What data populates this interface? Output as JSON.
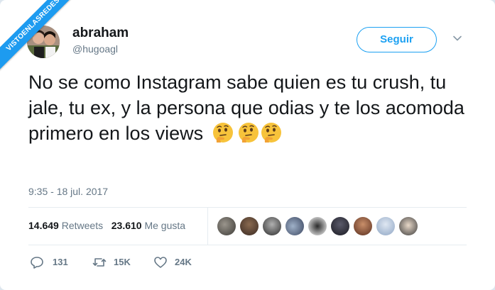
{
  "watermark": {
    "text": "VISTOENLASREDES"
  },
  "author": {
    "display_name": "abraham",
    "handle": "@hugoagl",
    "avatar_icon": "profile-photo"
  },
  "follow_button": {
    "label": "Seguir",
    "color": "#1da1f2"
  },
  "menu": {
    "icon": "chevron-down-icon"
  },
  "tweet": {
    "text": "No se como Instagram sabe quien es tu crush, tu jale, tu ex, y la persona que odias y te los acomoda primero en los views",
    "emojis": [
      "thinking-face",
      "thinking-face",
      "thinking-face"
    ],
    "timestamp": "9:35 - 18 jul. 2017"
  },
  "stats": {
    "retweets_count": "14.649",
    "retweets_label": "Retweets",
    "likes_count": "23.610",
    "likes_label": "Me gusta"
  },
  "likers": {
    "count": 9
  },
  "actions": {
    "reply_count": "131",
    "retweet_count": "15K",
    "like_count": "24K"
  }
}
